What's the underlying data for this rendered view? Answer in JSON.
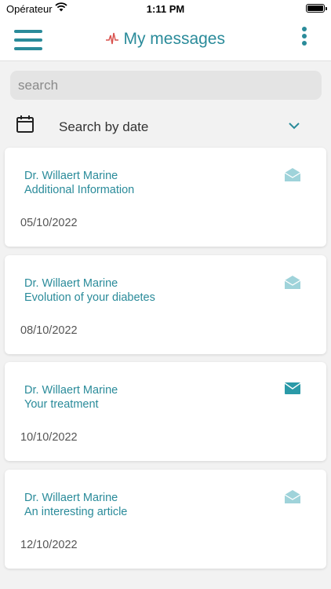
{
  "status_bar": {
    "carrier": "Opérateur",
    "time": "1:11 PM"
  },
  "header": {
    "title": "My messages"
  },
  "search": {
    "placeholder": "search"
  },
  "date_filter": {
    "label": "Search by date"
  },
  "colors": {
    "accent": "#2a8b9a",
    "read_icon": "#9fd3da",
    "unread_icon": "#2a9aa8"
  },
  "messages": [
    {
      "sender": "Dr. Willaert Marine",
      "subject": "Additional Information",
      "date": "05/10/2022",
      "status": "read",
      "icon": "envelope-open-icon"
    },
    {
      "sender": "Dr. Willaert Marine",
      "subject": "Evolution of your diabetes",
      "date": "08/10/2022",
      "status": "read",
      "icon": "envelope-open-icon"
    },
    {
      "sender": "Dr. Willaert Marine",
      "subject": "Your treatment",
      "date": "10/10/2022",
      "status": "unread",
      "icon": "envelope-closed-icon"
    },
    {
      "sender": "Dr. Willaert Marine",
      "subject": "An interesting article",
      "date": "12/10/2022",
      "status": "read",
      "icon": "envelope-open-icon"
    }
  ]
}
